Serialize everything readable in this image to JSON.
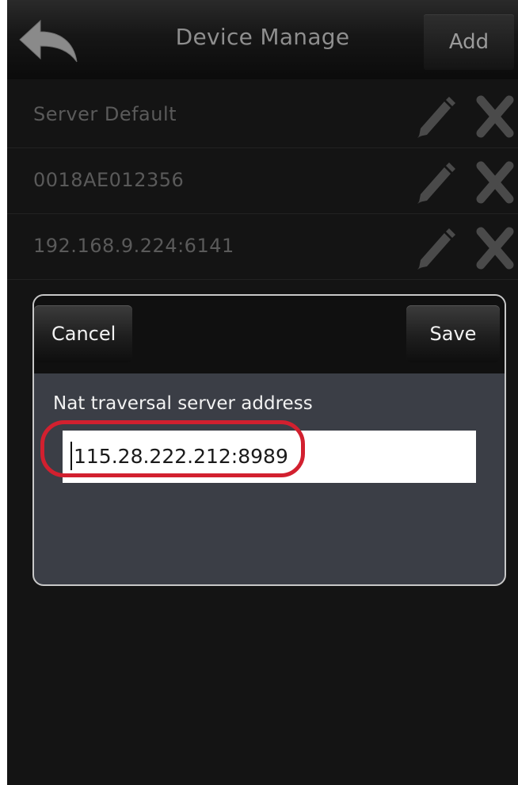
{
  "header": {
    "title": "Device Manage",
    "add_label": "Add",
    "back_icon": "back-arrow-icon"
  },
  "devices": [
    {
      "label": "Server Default"
    },
    {
      "label": "0018AE012356"
    },
    {
      "label": "192.168.9.224:6141"
    }
  ],
  "dialog": {
    "cancel_label": "Cancel",
    "save_label": "Save",
    "field_label": "Nat traversal server address",
    "field_value": "115.28.222.212:8989"
  },
  "colors": {
    "background": "#141414",
    "dialog_bg": "#3b3e46",
    "highlight": "#d2202f"
  }
}
